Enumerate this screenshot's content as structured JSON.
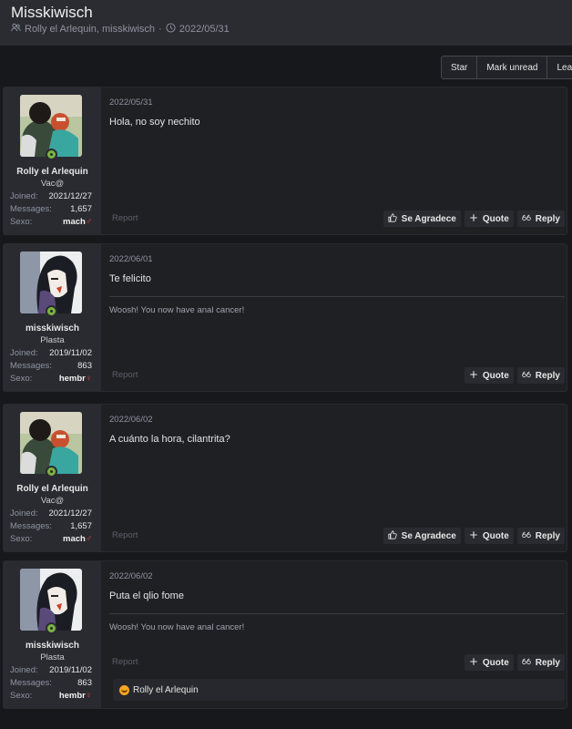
{
  "header": {
    "title": "Misskiwisch",
    "participants": "Rolly el Arlequin, misskiwisch",
    "separator": "·",
    "date": "2022/05/31"
  },
  "toolbar": {
    "star": "Star",
    "mark_unread": "Mark unread",
    "leave": "Leave"
  },
  "labels": {
    "joined": "Joined:",
    "messages": "Messages:",
    "sexo": "Sexo:",
    "report": "Report",
    "like": "Se Agradece",
    "quote": "Quote",
    "reply": "Reply"
  },
  "posts": [
    {
      "user": "Rolly el Arlequin",
      "user_title": "Vac@",
      "joined": "2021/12/27",
      "messages": "1,657",
      "sexo_text": "mach",
      "sexo_symbol": "♂",
      "date": "2022/05/31",
      "text": "Hola, no soy nechito"
    },
    {
      "user": "misskiwisch",
      "user_title": "Plasta",
      "joined": "2019/11/02",
      "messages": "863",
      "sexo_text": "hembr",
      "sexo_symbol": "♀",
      "date": "2022/06/01",
      "text": "Te felicito",
      "signature": "Woosh! You now have anal cancer!"
    },
    {
      "user": "Rolly el Arlequin",
      "user_title": "Vac@",
      "joined": "2021/12/27",
      "messages": "1,657",
      "sexo_text": "mach",
      "sexo_symbol": "♂",
      "date": "2022/06/02",
      "text": "A cuánto la hora, cilantrita?"
    },
    {
      "user": "misskiwisch",
      "user_title": "Plasta",
      "joined": "2019/11/02",
      "messages": "863",
      "sexo_text": "hembr",
      "sexo_symbol": "♀",
      "date": "2022/06/02",
      "text": "Puta el qlio fome",
      "signature": "Woosh! You now have anal cancer!",
      "reaction_user": "Rolly el Arlequin"
    }
  ],
  "colors": {
    "background": "#17181c",
    "panel": "#1f2024",
    "user_panel": "#2a2b31",
    "online": "#7cb342",
    "sex_symbol": "#e0403a"
  }
}
